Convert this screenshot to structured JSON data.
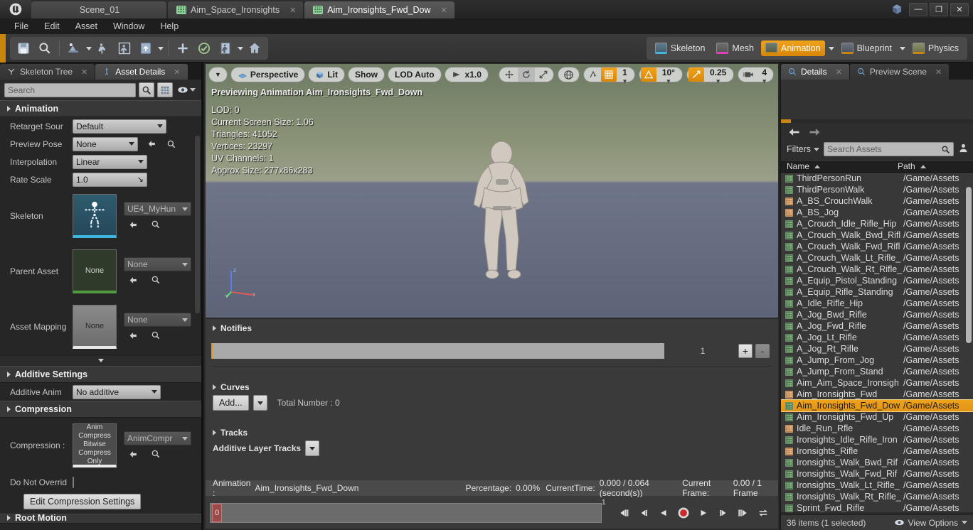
{
  "window": {
    "title_tabs": [
      {
        "label": "Scene_01",
        "icon": "",
        "closable": false
      },
      {
        "label": "Aim_Space_Ironsights",
        "icon": "anim-asset-icon",
        "closable": true
      },
      {
        "label": "Aim_Ironsights_Fwd_Dow",
        "icon": "anim-asset-icon",
        "closable": true
      }
    ],
    "controls": {
      "minimize": "—",
      "maximize": "❐",
      "close": "✕"
    }
  },
  "menu": {
    "items": [
      "File",
      "Edit",
      "Asset",
      "Window",
      "Help"
    ]
  },
  "toolbar": {
    "buttons": [
      "save-icon",
      "find-in-cb-icon",
      "new-anim-icon",
      "apply-compression-icon",
      "reimport-icon",
      "import-icon",
      "add-icon",
      "preview-icon",
      "anim-mode-icon",
      "home-icon"
    ],
    "modes": [
      {
        "label": "Skeleton",
        "active": false
      },
      {
        "label": "Mesh",
        "active": false
      },
      {
        "label": "Animation",
        "active": true
      },
      {
        "label": "Blueprint",
        "active": false
      },
      {
        "label": "Physics",
        "active": false
      }
    ]
  },
  "left_panel": {
    "tabs": [
      {
        "label": "Skeleton Tree",
        "active": false
      },
      {
        "label": "Asset Details",
        "active": true
      }
    ],
    "search_placeholder": "Search",
    "sections": {
      "animation": {
        "title": "Animation",
        "rows": [
          {
            "label": "Retarget Sour",
            "value": "Default"
          },
          {
            "label": "Preview Pose",
            "value": "None"
          },
          {
            "label": "Interpolation",
            "value": "Linear"
          },
          {
            "label": "Rate Scale",
            "value": "1.0"
          }
        ],
        "skeleton": {
          "label": "Skeleton",
          "thumb": "",
          "value": "UE4_MyHun"
        },
        "parent_asset": {
          "label": "Parent Asset",
          "thumb": "None",
          "value": "None"
        },
        "asset_mapping": {
          "label": "Asset Mapping",
          "thumb": "None",
          "value": "None"
        }
      },
      "additive": {
        "title": "Additive Settings",
        "row": {
          "label": "Additive Anim",
          "value": "No additive"
        }
      },
      "compression": {
        "title": "Compression",
        "row": {
          "label": "Compression :",
          "thumb": "Anim Compress Bitwise Compress Only",
          "value": "AnimCompr"
        },
        "do_not_override": {
          "label": "Do Not Overrid",
          "checked": false
        },
        "edit_button": "Edit Compression Settings"
      },
      "root_motion": {
        "title": "Root Motion"
      }
    }
  },
  "viewport": {
    "toolbar": {
      "menu_caret": "▼",
      "perspective": "Perspective",
      "lit": "Lit",
      "show": "Show",
      "lod": "LOD Auto",
      "playrate": "x1.0"
    },
    "right_toolbar": {
      "grid_snap": "1",
      "rotation_snap": "10°",
      "scale_snap": "0.25",
      "camera_speed": "4"
    },
    "overlay": {
      "header": "Previewing Animation Aim_Ironsights_Fwd_Down",
      "stats": [
        "LOD: 0",
        "Current Screen Size: 1.06",
        "Triangles: 41052",
        "Vertices: 23297",
        "UV Channels: 1",
        "Approx Size: 277x86x283"
      ]
    },
    "axis_labels": {
      "x": "x",
      "y": "y",
      "z": "z"
    }
  },
  "lower_panel": {
    "notifies": {
      "title": "Notifies",
      "count": "1",
      "add": "+",
      "remove": "-"
    },
    "curves": {
      "title": "Curves",
      "add_label": "Add...",
      "total": "Total Number : 0"
    },
    "tracks": {
      "title": "Tracks",
      "layer_label": "Additive Layer Tracks"
    },
    "status": {
      "animation_label": "Animation :",
      "animation_name": "Aim_Ironsights_Fwd_Down",
      "percentage_label": "Percentage:",
      "percentage_value": "0.00%",
      "currenttime_label": "CurrentTime:",
      "currenttime_value": "0.000 / 0.064 (second(s))",
      "currentframe_label": "Current Frame:",
      "currentframe_value": "0.00 / 1 Frame"
    },
    "scrubber": {
      "start": "0",
      "end": "1"
    },
    "transport": [
      "step-back-end-icon",
      "step-back-icon",
      "play-reverse-icon",
      "record-icon",
      "play-icon",
      "step-forward-icon",
      "step-forward-end-icon",
      "loop-icon"
    ]
  },
  "right_panel": {
    "tabs": [
      {
        "label": "Details",
        "active": true
      },
      {
        "label": "Preview Scene",
        "active": false
      }
    ],
    "content_browser": {
      "filters_label": "Filters",
      "search_placeholder": "Search Assets",
      "columns": {
        "name": "Name",
        "path": "Path"
      },
      "rows": [
        {
          "name": "ThirdPersonRun",
          "path": "/Game/Assets",
          "kind": "green",
          "selected": false
        },
        {
          "name": "ThirdPersonWalk",
          "path": "/Game/Assets",
          "kind": "green",
          "selected": false
        },
        {
          "name": "A_BS_CrouchWalk",
          "path": "/Game/Assets",
          "kind": "peach",
          "selected": false
        },
        {
          "name": "A_BS_Jog",
          "path": "/Game/Assets",
          "kind": "peach",
          "selected": false
        },
        {
          "name": "A_Crouch_Idle_Rifle_Hip",
          "path": "/Game/Assets",
          "kind": "green",
          "selected": false
        },
        {
          "name": "A_Crouch_Walk_Bwd_Rifl",
          "path": "/Game/Assets",
          "kind": "green",
          "selected": false
        },
        {
          "name": "A_Crouch_Walk_Fwd_Rifl",
          "path": "/Game/Assets",
          "kind": "green",
          "selected": false
        },
        {
          "name": "A_Crouch_Walk_Lt_Rifle_",
          "path": "/Game/Assets",
          "kind": "green",
          "selected": false
        },
        {
          "name": "A_Crouch_Walk_Rt_Rifle_",
          "path": "/Game/Assets",
          "kind": "green",
          "selected": false
        },
        {
          "name": "A_Equip_Pistol_Standing",
          "path": "/Game/Assets",
          "kind": "green",
          "selected": false
        },
        {
          "name": "A_Equip_Rifle_Standing",
          "path": "/Game/Assets",
          "kind": "green",
          "selected": false
        },
        {
          "name": "A_Idle_Rifle_Hip",
          "path": "/Game/Assets",
          "kind": "green",
          "selected": false
        },
        {
          "name": "A_Jog_Bwd_Rifle",
          "path": "/Game/Assets",
          "kind": "green",
          "selected": false
        },
        {
          "name": "A_Jog_Fwd_Rifle",
          "path": "/Game/Assets",
          "kind": "green",
          "selected": false
        },
        {
          "name": "A_Jog_Lt_Rifle",
          "path": "/Game/Assets",
          "kind": "green",
          "selected": false
        },
        {
          "name": "A_Jog_Rt_Rifle",
          "path": "/Game/Assets",
          "kind": "green",
          "selected": false
        },
        {
          "name": "A_Jump_From_Jog",
          "path": "/Game/Assets",
          "kind": "green",
          "selected": false
        },
        {
          "name": "A_Jump_From_Stand",
          "path": "/Game/Assets",
          "kind": "green",
          "selected": false
        },
        {
          "name": "Aim_Aim_Space_Ironsigh",
          "path": "/Game/Assets",
          "kind": "green",
          "selected": false
        },
        {
          "name": "Aim_Ironsights_Fwd",
          "path": "/Game/Assets",
          "kind": "peach",
          "selected": false
        },
        {
          "name": "Aim_Ironsights_Fwd_Dow",
          "path": "/Game/Assets",
          "kind": "green",
          "selected": true
        },
        {
          "name": "Aim_Ironsights_Fwd_Up",
          "path": "/Game/Assets",
          "kind": "green",
          "selected": false
        },
        {
          "name": "Idle_Run_Rfle",
          "path": "/Game/Assets",
          "kind": "peach",
          "selected": false
        },
        {
          "name": "Ironsights_Idle_Rifle_Iron",
          "path": "/Game/Assets",
          "kind": "green",
          "selected": false
        },
        {
          "name": "Ironsights_Rifle",
          "path": "/Game/Assets",
          "kind": "peach",
          "selected": false
        },
        {
          "name": "Ironsights_Walk_Bwd_Rif",
          "path": "/Game/Assets",
          "kind": "green",
          "selected": false
        },
        {
          "name": "Ironsights_Walk_Fwd_Rif",
          "path": "/Game/Assets",
          "kind": "green",
          "selected": false
        },
        {
          "name": "Ironsights_Walk_Lt_Rifle_",
          "path": "/Game/Assets",
          "kind": "green",
          "selected": false
        },
        {
          "name": "Ironsights_Walk_Rt_Rifle_",
          "path": "/Game/Assets",
          "kind": "green",
          "selected": false
        },
        {
          "name": "Sprint_Fwd_Rifle",
          "path": "/Game/Assets",
          "kind": "green",
          "selected": false
        }
      ],
      "status": {
        "items": "36 items (1 selected)",
        "view_options": "View Options"
      }
    }
  },
  "colors": {
    "accent_orange": "#e09416",
    "panel_bg": "#2a2a2a",
    "toolbar_bg": "#3b3b3b",
    "selected_row": "#f0a21c"
  }
}
